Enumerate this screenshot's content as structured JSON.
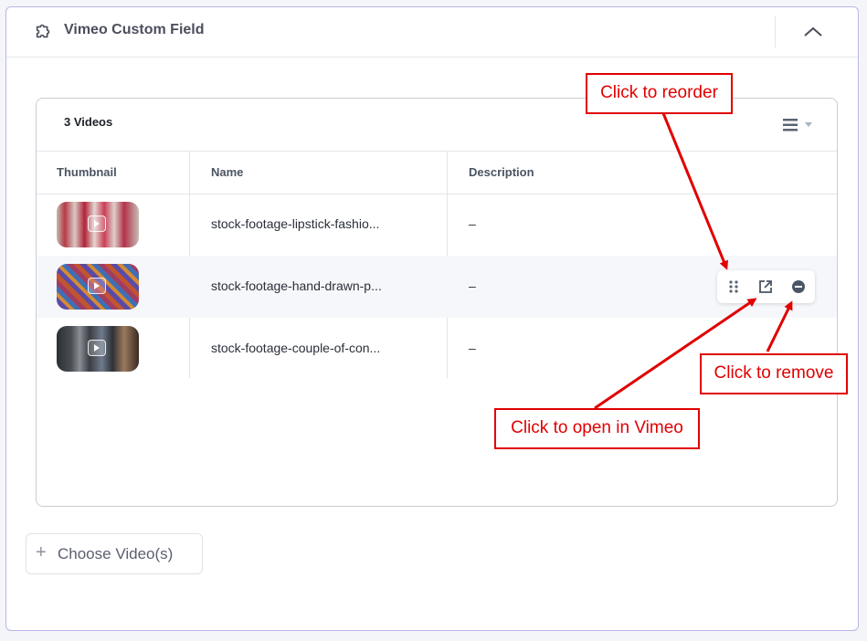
{
  "panel": {
    "title": "Vimeo Custom Field",
    "icon": "plugin-puzzle-icon",
    "collapse_icon": "chevron-up-icon"
  },
  "table": {
    "count_label": "3 Videos",
    "menu_icon": "list-menu-icon",
    "columns": [
      "Thumbnail",
      "Name",
      "Description"
    ],
    "rows": [
      {
        "thumbnail": "lipstick-thumbnail",
        "name": "stock-footage-lipstick-fashio...",
        "description": "–"
      },
      {
        "thumbnail": "pattern-thumbnail",
        "name": "stock-footage-hand-drawn-p...",
        "description": "–"
      },
      {
        "thumbnail": "couple-thumbnail",
        "name": "stock-footage-couple-of-con...",
        "description": "–"
      }
    ]
  },
  "row_actions": {
    "icons": [
      "drag-handle-icon",
      "external-link-icon",
      "remove-circle-icon"
    ]
  },
  "choose_button": {
    "label": "Choose Video(s)",
    "icon": "plus-icon"
  },
  "annotations": {
    "reorder": "Click to reorder",
    "open": "Click to open in Vimeo",
    "remove": "Click to remove"
  },
  "colors": {
    "panel_border": "#b9b6e6",
    "annotation_red": "#e00000",
    "header_text": "#4a4f5c"
  }
}
